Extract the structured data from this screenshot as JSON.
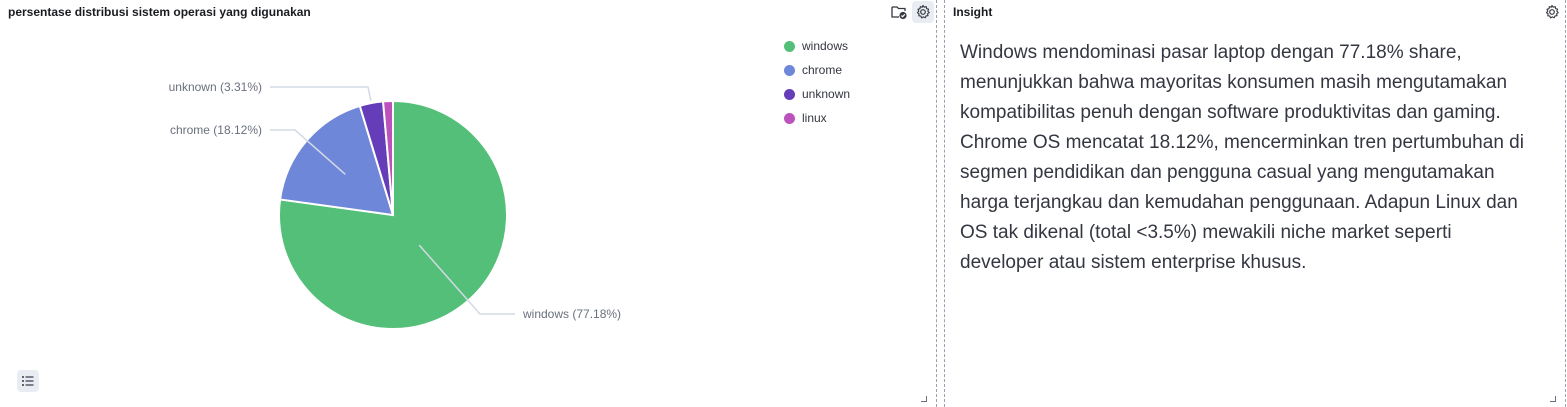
{
  "left_panel": {
    "title": "persentase distribusi sistem operasi yang digunakan"
  },
  "right_panel": {
    "title": "Insight",
    "text": "Windows mendominasi pasar laptop dengan 77.18% share, menunjukkan bahwa mayoritas konsumen masih mengutamakan kompatibilitas penuh dengan software produktivitas dan gaming. Chrome OS mencatat 18.12%, mencerminkan tren pertumbuhan di segmen pendidikan dan pengguna casual yang mengutamakan harga terjangkau dan kemudahan penggunaan. Adapun Linux dan OS tak dikenal (total <3.5%) mewakili niche market seperti developer atau sistem enterprise khusus."
  },
  "icons": {
    "folder_check": "folder-check-icon",
    "settings": "gear-icon",
    "legend_toggle": "list-icon"
  },
  "chart_data": {
    "type": "pie",
    "slices": [
      {
        "name": "windows",
        "value": 77.18,
        "label": "windows (77.18%)",
        "color": "#54bf78"
      },
      {
        "name": "chrome",
        "value": 18.12,
        "label": "chrome (18.12%)",
        "color": "#6f87d8"
      },
      {
        "name": "unknown",
        "value": 3.31,
        "label": "unknown (3.31%)",
        "color": "#663db8"
      },
      {
        "name": "linux",
        "value": 1.39,
        "color": "#bc52bc"
      }
    ],
    "legend": [
      "windows",
      "chrome",
      "unknown",
      "linux"
    ],
    "legend_position": "top-right"
  }
}
